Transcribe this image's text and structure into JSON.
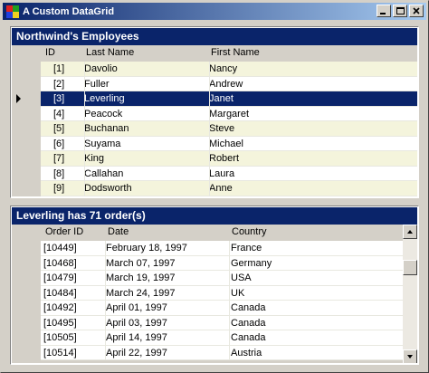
{
  "window": {
    "title": "A Custom DataGrid",
    "buttons": [
      "minimize",
      "maximize",
      "close"
    ]
  },
  "employees_grid": {
    "caption": "Northwind's Employees",
    "columns": [
      "ID",
      "Last Name",
      "First Name"
    ],
    "selected_index": 2,
    "colors": {
      "alt_row": "#f4f4dc",
      "row": "#ffffff",
      "selected": "#0a246a",
      "selected_text": "#ffffff"
    },
    "rows": [
      {
        "id": "[1]",
        "last": "Davolio",
        "first": "Nancy"
      },
      {
        "id": "[2]",
        "last": "Fuller",
        "first": "Andrew"
      },
      {
        "id": "[3]",
        "last": "Leverling",
        "first": "Janet"
      },
      {
        "id": "[4]",
        "last": "Peacock",
        "first": "Margaret"
      },
      {
        "id": "[5]",
        "last": "Buchanan",
        "first": "Steve"
      },
      {
        "id": "[6]",
        "last": "Suyama",
        "first": "Michael"
      },
      {
        "id": "[7]",
        "last": "King",
        "first": "Robert"
      },
      {
        "id": "[8]",
        "last": "Callahan",
        "first": "Laura"
      },
      {
        "id": "[9]",
        "last": "Dodsworth",
        "first": "Anne"
      }
    ]
  },
  "orders_grid": {
    "caption": "Leverling has 71 order(s)",
    "columns": [
      "Order ID",
      "Date",
      "Country"
    ],
    "rows": [
      {
        "order": "[10449]",
        "date": "February 18, 1997",
        "country": "France"
      },
      {
        "order": "[10468]",
        "date": "March 07, 1997",
        "country": "Germany"
      },
      {
        "order": "[10479]",
        "date": "March 19, 1997",
        "country": "USA"
      },
      {
        "order": "[10484]",
        "date": "March 24, 1997",
        "country": "UK"
      },
      {
        "order": "[10492]",
        "date": "April 01, 1997",
        "country": "Canada"
      },
      {
        "order": "[10495]",
        "date": "April 03, 1997",
        "country": "Canada"
      },
      {
        "order": "[10505]",
        "date": "April 14, 1997",
        "country": "Canada"
      },
      {
        "order": "[10514]",
        "date": "April 22, 1997",
        "country": "Austria"
      }
    ]
  }
}
